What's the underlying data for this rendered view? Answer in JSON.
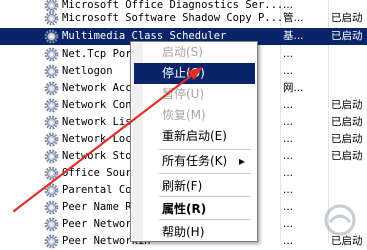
{
  "services": [
    {
      "name": "Microsoft Office Diagnostics Ser...",
      "desc": "...",
      "status": ""
    },
    {
      "name": "Microsoft Software Shadow Copy P...",
      "desc": "管...",
      "status": "已启动"
    },
    {
      "name": "Multimedia Class Scheduler",
      "desc": "基...",
      "status": "已启动",
      "selected": true
    },
    {
      "name": "Net.Tcp Port S",
      "desc": "...",
      "status": ""
    },
    {
      "name": "Netlogon",
      "desc": "...",
      "status": ""
    },
    {
      "name": "Network Access",
      "desc": "网...",
      "status": ""
    },
    {
      "name": "Network Connec",
      "desc": "...",
      "status": "已启动"
    },
    {
      "name": "Network List S",
      "desc": "...",
      "status": "已启动"
    },
    {
      "name": "Network Locati",
      "desc": "...",
      "status": "已启动"
    },
    {
      "name": "Network Store",
      "desc": "...",
      "status": "已启动"
    },
    {
      "name": "Office Source",
      "desc": "...",
      "status": ""
    },
    {
      "name": "Parental Contr",
      "desc": "...",
      "status": ""
    },
    {
      "name": "Peer Name Reso",
      "desc": "...",
      "status": ""
    },
    {
      "name": "Peer Networkin",
      "desc": "...",
      "status": ""
    },
    {
      "name": "Peer Networkin",
      "desc": "...",
      "status": "已启动"
    }
  ],
  "context_menu": {
    "items": [
      {
        "label": "启动(S)",
        "state": "disabled"
      },
      {
        "label": "停止(O)",
        "state": "highlighted"
      },
      {
        "label": "暂停(U)",
        "state": "disabled"
      },
      {
        "label": "恢复(M)",
        "state": "disabled"
      },
      {
        "label": "重新启动(E)",
        "state": "enabled"
      },
      {
        "label": "所有任务(K)",
        "state": "enabled",
        "submenu": true,
        "arrow": "▸"
      },
      {
        "label": "刷新(F)",
        "state": "enabled"
      },
      {
        "label": "属性(R)",
        "state": "bold"
      },
      {
        "label": "帮助(H)",
        "state": "enabled"
      }
    ]
  },
  "colors": {
    "selection": "#0a246a",
    "annotation_arrow": "#e0302a"
  }
}
